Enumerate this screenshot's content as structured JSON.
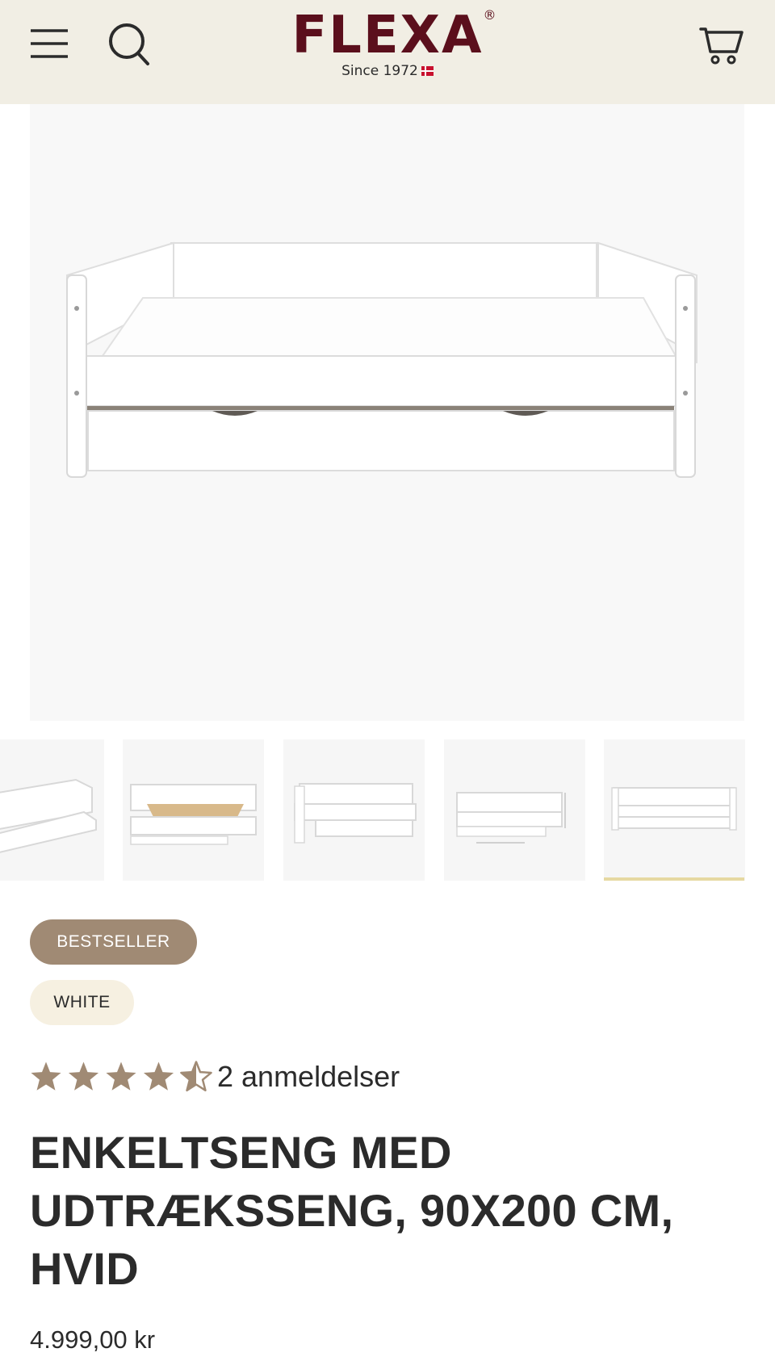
{
  "header": {
    "logo_text": "FLEXA",
    "logo_registered": "®",
    "logo_tagline": "Since 1972",
    "menu_icon": "hamburger-menu-icon",
    "search_icon": "search-icon",
    "cart_icon": "shopping-cart-icon"
  },
  "gallery": {
    "thumbnail_count": 5,
    "active_thumbnail": 5
  },
  "product": {
    "badges": [
      "BESTSELLER",
      "WHITE"
    ],
    "rating": 4.5,
    "rating_max": 5,
    "review_text": "2 anmeldelser",
    "title": "ENKELTSENG MED UDTRÆKSSENG, 90X200 CM, HVID",
    "price": "4.999,00 kr"
  },
  "colors": {
    "header_bg": "#f1eee4",
    "logo": "#5b0f1c",
    "bestseller_badge": "#a08a74",
    "color_badge": "#f6f0e1",
    "star": "#a08a74",
    "active_thumb_bar": "#e6d9a2"
  }
}
